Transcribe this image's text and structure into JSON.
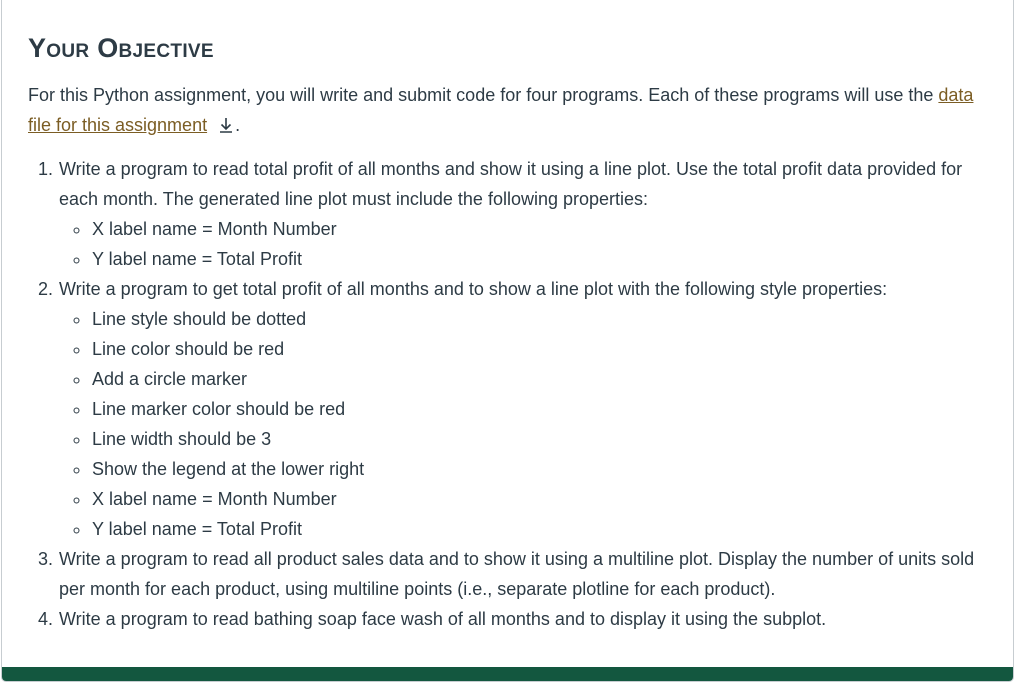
{
  "heading": "Your Objective",
  "intro": {
    "before": "For this Python assignment, you will write and submit code for four programs. Each of these programs will use the ",
    "link": "data file for this assignment",
    "after": "."
  },
  "tasks": [
    {
      "text": "Write a program to read total profit of all months and show it using a line plot. Use the total profit data provided for each month. The generated line plot must include the following properties:",
      "bullets": [
        "X label name = Month Number",
        "Y label name = Total Profit"
      ]
    },
    {
      "text": "Write a program to get total profit of all months and to show a line plot with the following style properties:",
      "bullets": [
        "Line style should be dotted",
        "Line color should be red",
        "Add a circle marker",
        "Line marker color should be red",
        "Line width should be 3",
        "Show the legend at the lower right",
        "X label name = Month Number",
        "Y label name = Total Profit"
      ]
    },
    {
      "text": "Write a program to read all product sales data and to show it using a multiline plot. Display the number of units sold per month for each product, using multiline points (i.e., separate plotline for each product).",
      "bullets": []
    },
    {
      "text": "Write a program to read bathing soap face wash of all months and to display it using the subplot.",
      "bullets": []
    }
  ],
  "colors": {
    "text": "#2d3b45",
    "link": "#7b5d24",
    "footer": "#13573f"
  }
}
